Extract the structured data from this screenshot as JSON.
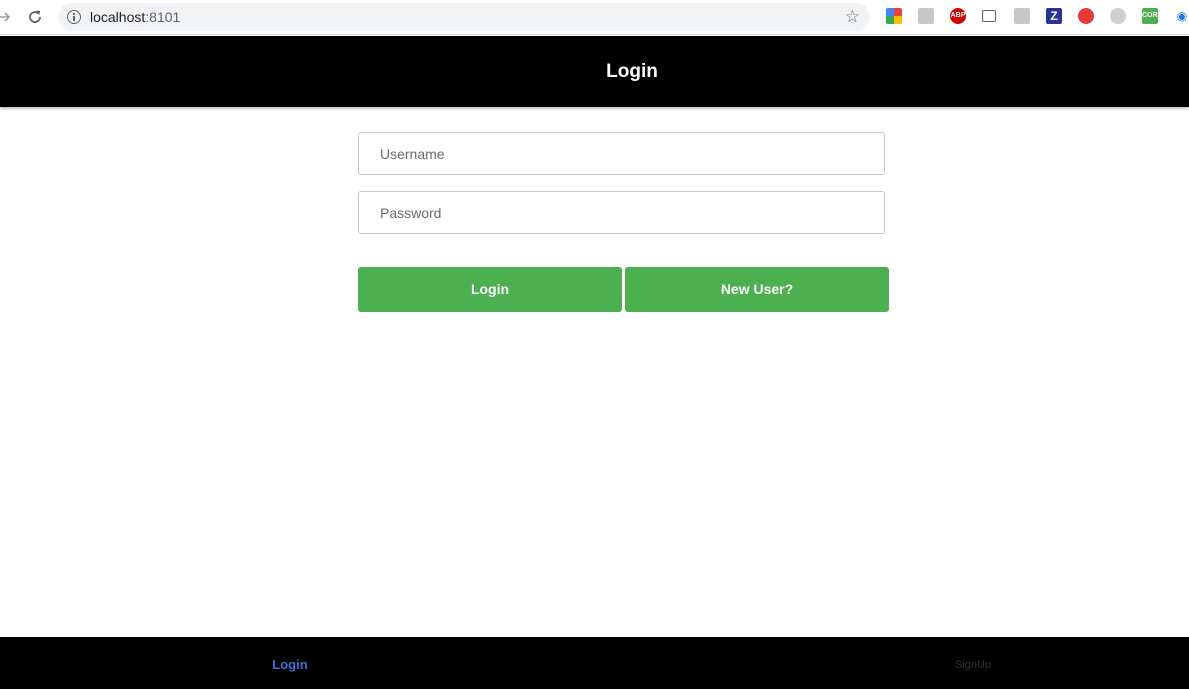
{
  "browser": {
    "url_host": "localhost",
    "url_port": ":8101",
    "extensions": [
      {
        "name": "puzzle-color-icon",
        "label": "",
        "color": "#34a853"
      },
      {
        "name": "gray-tool-icon",
        "label": "",
        "color": "#c7c7c7"
      },
      {
        "name": "adblock-icon",
        "label": "ABP",
        "color": "#d30000"
      },
      {
        "name": "cast-icon",
        "label": "",
        "color": "#ffffff"
      },
      {
        "name": "pdf-icon",
        "label": "",
        "color": "#c7c7c7"
      },
      {
        "name": "z-extension-icon",
        "label": "Z",
        "color": "#283593"
      },
      {
        "name": "opera-icon",
        "label": "",
        "color": "#e53935"
      },
      {
        "name": "gray-circle-icon",
        "label": "",
        "color": "#d0d0d0"
      },
      {
        "name": "cors-icon",
        "label": "CORS",
        "color": "#4caf50"
      },
      {
        "name": "eye-icon",
        "label": "",
        "color": "#ffffff"
      }
    ]
  },
  "header": {
    "title": "Login"
  },
  "form": {
    "username_placeholder": "Username",
    "password_placeholder": "Password",
    "login_label": "Login",
    "new_user_label": "New User?"
  },
  "tabs": {
    "login_label": "Login",
    "signup_label": "SignUp"
  },
  "colors": {
    "accent": "#4caf50",
    "active_tab": "#3f6fd8",
    "header_bg": "#000000"
  }
}
